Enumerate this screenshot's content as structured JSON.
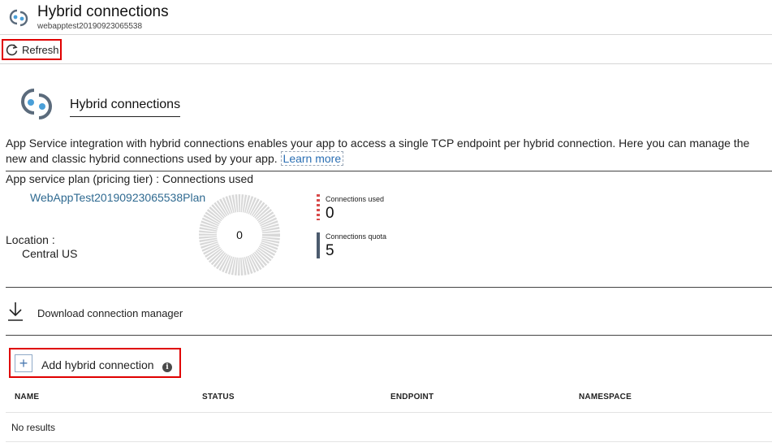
{
  "header": {
    "title": "Hybrid connections",
    "subtitle": "webapptest20190923065538",
    "icon": "hybrid-connections-icon"
  },
  "toolbar": {
    "refresh_label": "Refresh",
    "refresh_icon": "refresh-icon"
  },
  "section": {
    "title": "Hybrid connections",
    "description": "App Service integration with hybrid connections enables your app to access a single TCP endpoint per hybrid connection. Here you can manage the new and classic hybrid connections used by your app.",
    "learn_more": "Learn more"
  },
  "plan": {
    "label": "App service plan (pricing tier) : Connections used",
    "name": "WebAppTest20190923065538Plan",
    "location_label": "Location :",
    "location_value": "Central US"
  },
  "usage": {
    "center_value": "0",
    "used_label": "Connections used",
    "used_value": "0",
    "quota_label": "Connections quota",
    "quota_value": "5",
    "used_fraction": 0,
    "colors": {
      "used": "#d84a4a",
      "quota": "#4c5b6e",
      "ring": "#d8d8d8"
    }
  },
  "actions": {
    "download_label": "Download connection manager",
    "add_label": "Add hybrid connection",
    "accent": "#e00000"
  },
  "table": {
    "columns": [
      "NAME",
      "STATUS",
      "ENDPOINT",
      "NAMESPACE"
    ],
    "empty_text": "No results"
  }
}
